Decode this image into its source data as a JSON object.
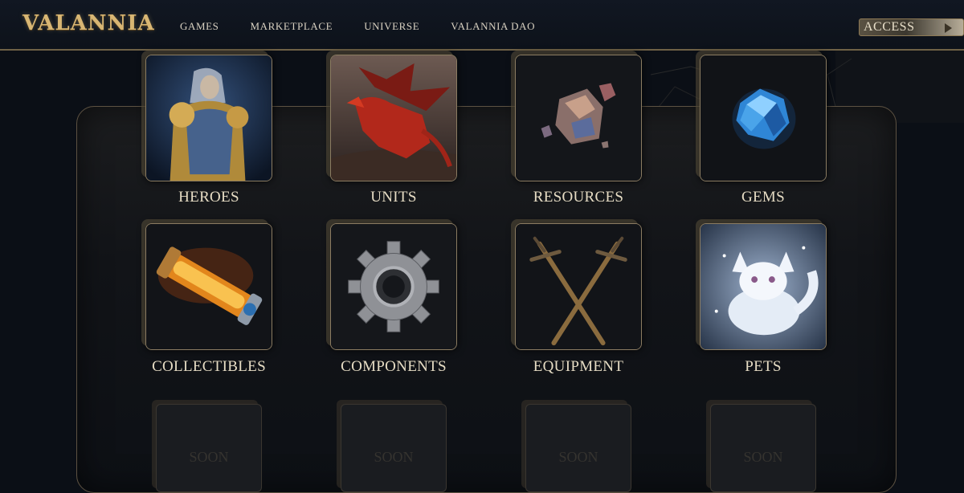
{
  "header": {
    "logo": "VALANNIA",
    "nav": [
      "GAMES",
      "MARKETPLACE",
      "UNIVERSE",
      "VALANNIA DAO"
    ],
    "access_label": "ACCESS"
  },
  "categories": [
    {
      "label": "HEROES",
      "icon": "hero-knight-icon"
    },
    {
      "label": "UNITS",
      "icon": "dragon-icon"
    },
    {
      "label": "RESOURCES",
      "icon": "ore-rocks-icon"
    },
    {
      "label": "GEMS",
      "icon": "blue-gem-icon"
    },
    {
      "label": "COLLECTIBLES",
      "icon": "glowing-vial-icon"
    },
    {
      "label": "COMPONENTS",
      "icon": "gear-icon"
    },
    {
      "label": "EQUIPMENT",
      "icon": "crossed-swords-icon"
    },
    {
      "label": "PETS",
      "icon": "frost-fox-icon"
    }
  ],
  "coming_soon": [
    "SOON",
    "SOON",
    "SOON",
    "SOON"
  ],
  "colors": {
    "accent_gold": "#d8b673",
    "border_gold": "#8b7c62",
    "background": "#0b0f16"
  }
}
